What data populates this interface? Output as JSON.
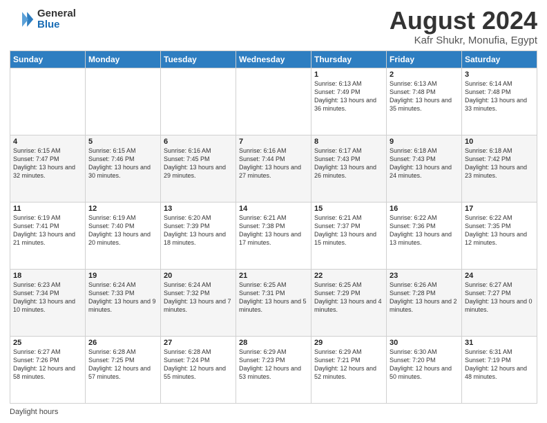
{
  "logo": {
    "general": "General",
    "blue": "Blue"
  },
  "header": {
    "title": "August 2024",
    "subtitle": "Kafr Shukr, Monufia, Egypt"
  },
  "footer": {
    "label": "Daylight hours"
  },
  "days_of_week": [
    "Sunday",
    "Monday",
    "Tuesday",
    "Wednesday",
    "Thursday",
    "Friday",
    "Saturday"
  ],
  "weeks": [
    [
      {
        "day": "",
        "content": ""
      },
      {
        "day": "",
        "content": ""
      },
      {
        "day": "",
        "content": ""
      },
      {
        "day": "",
        "content": ""
      },
      {
        "day": "1",
        "content": "Sunrise: 6:13 AM\nSunset: 7:49 PM\nDaylight: 13 hours and 36 minutes."
      },
      {
        "day": "2",
        "content": "Sunrise: 6:13 AM\nSunset: 7:48 PM\nDaylight: 13 hours and 35 minutes."
      },
      {
        "day": "3",
        "content": "Sunrise: 6:14 AM\nSunset: 7:48 PM\nDaylight: 13 hours and 33 minutes."
      }
    ],
    [
      {
        "day": "4",
        "content": "Sunrise: 6:15 AM\nSunset: 7:47 PM\nDaylight: 13 hours and 32 minutes."
      },
      {
        "day": "5",
        "content": "Sunrise: 6:15 AM\nSunset: 7:46 PM\nDaylight: 13 hours and 30 minutes."
      },
      {
        "day": "6",
        "content": "Sunrise: 6:16 AM\nSunset: 7:45 PM\nDaylight: 13 hours and 29 minutes."
      },
      {
        "day": "7",
        "content": "Sunrise: 6:16 AM\nSunset: 7:44 PM\nDaylight: 13 hours and 27 minutes."
      },
      {
        "day": "8",
        "content": "Sunrise: 6:17 AM\nSunset: 7:43 PM\nDaylight: 13 hours and 26 minutes."
      },
      {
        "day": "9",
        "content": "Sunrise: 6:18 AM\nSunset: 7:43 PM\nDaylight: 13 hours and 24 minutes."
      },
      {
        "day": "10",
        "content": "Sunrise: 6:18 AM\nSunset: 7:42 PM\nDaylight: 13 hours and 23 minutes."
      }
    ],
    [
      {
        "day": "11",
        "content": "Sunrise: 6:19 AM\nSunset: 7:41 PM\nDaylight: 13 hours and 21 minutes."
      },
      {
        "day": "12",
        "content": "Sunrise: 6:19 AM\nSunset: 7:40 PM\nDaylight: 13 hours and 20 minutes."
      },
      {
        "day": "13",
        "content": "Sunrise: 6:20 AM\nSunset: 7:39 PM\nDaylight: 13 hours and 18 minutes."
      },
      {
        "day": "14",
        "content": "Sunrise: 6:21 AM\nSunset: 7:38 PM\nDaylight: 13 hours and 17 minutes."
      },
      {
        "day": "15",
        "content": "Sunrise: 6:21 AM\nSunset: 7:37 PM\nDaylight: 13 hours and 15 minutes."
      },
      {
        "day": "16",
        "content": "Sunrise: 6:22 AM\nSunset: 7:36 PM\nDaylight: 13 hours and 13 minutes."
      },
      {
        "day": "17",
        "content": "Sunrise: 6:22 AM\nSunset: 7:35 PM\nDaylight: 13 hours and 12 minutes."
      }
    ],
    [
      {
        "day": "18",
        "content": "Sunrise: 6:23 AM\nSunset: 7:34 PM\nDaylight: 13 hours and 10 minutes."
      },
      {
        "day": "19",
        "content": "Sunrise: 6:24 AM\nSunset: 7:33 PM\nDaylight: 13 hours and 9 minutes."
      },
      {
        "day": "20",
        "content": "Sunrise: 6:24 AM\nSunset: 7:32 PM\nDaylight: 13 hours and 7 minutes."
      },
      {
        "day": "21",
        "content": "Sunrise: 6:25 AM\nSunset: 7:31 PM\nDaylight: 13 hours and 5 minutes."
      },
      {
        "day": "22",
        "content": "Sunrise: 6:25 AM\nSunset: 7:29 PM\nDaylight: 13 hours and 4 minutes."
      },
      {
        "day": "23",
        "content": "Sunrise: 6:26 AM\nSunset: 7:28 PM\nDaylight: 13 hours and 2 minutes."
      },
      {
        "day": "24",
        "content": "Sunrise: 6:27 AM\nSunset: 7:27 PM\nDaylight: 13 hours and 0 minutes."
      }
    ],
    [
      {
        "day": "25",
        "content": "Sunrise: 6:27 AM\nSunset: 7:26 PM\nDaylight: 12 hours and 58 minutes."
      },
      {
        "day": "26",
        "content": "Sunrise: 6:28 AM\nSunset: 7:25 PM\nDaylight: 12 hours and 57 minutes."
      },
      {
        "day": "27",
        "content": "Sunrise: 6:28 AM\nSunset: 7:24 PM\nDaylight: 12 hours and 55 minutes."
      },
      {
        "day": "28",
        "content": "Sunrise: 6:29 AM\nSunset: 7:23 PM\nDaylight: 12 hours and 53 minutes."
      },
      {
        "day": "29",
        "content": "Sunrise: 6:29 AM\nSunset: 7:21 PM\nDaylight: 12 hours and 52 minutes."
      },
      {
        "day": "30",
        "content": "Sunrise: 6:30 AM\nSunset: 7:20 PM\nDaylight: 12 hours and 50 minutes."
      },
      {
        "day": "31",
        "content": "Sunrise: 6:31 AM\nSunset: 7:19 PM\nDaylight: 12 hours and 48 minutes."
      }
    ]
  ]
}
